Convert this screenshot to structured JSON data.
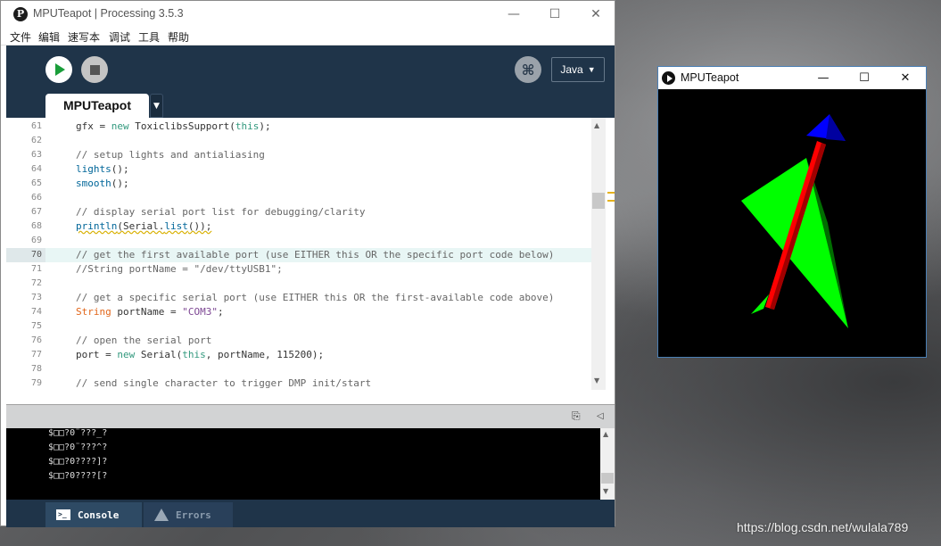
{
  "ide": {
    "title": "MPUTeapot | Processing 3.5.3",
    "app_icon": "P",
    "window_controls": {
      "minimize": "—",
      "maximize": "☐",
      "close": "✕"
    },
    "menu": [
      "文件",
      "编辑",
      "速写本",
      "调试",
      "工具",
      "帮助"
    ],
    "mode_label": "Java",
    "tab_label": "MPUTeapot",
    "code_lines": [
      {
        "num": "61",
        "text": "gfx = new ToxiclibsSupport(this);"
      },
      {
        "num": "62",
        "text": ""
      },
      {
        "num": "63",
        "text": "// setup lights and antialiasing"
      },
      {
        "num": "64",
        "text": "lights();"
      },
      {
        "num": "65",
        "text": "smooth();"
      },
      {
        "num": "66",
        "text": ""
      },
      {
        "num": "67",
        "text": "// display serial port list for debugging/clarity"
      },
      {
        "num": "68",
        "text": "println(Serial.list());"
      },
      {
        "num": "69",
        "text": ""
      },
      {
        "num": "70",
        "text": "// get the first available port (use EITHER this OR the specific port code below)"
      },
      {
        "num": "71",
        "text": "//String portName = \"/dev/ttyUSB1\";"
      },
      {
        "num": "72",
        "text": ""
      },
      {
        "num": "73",
        "text": "// get a specific serial port (use EITHER this OR the first-available code above)"
      },
      {
        "num": "74",
        "text": "String portName = \"COM3\";"
      },
      {
        "num": "75",
        "text": ""
      },
      {
        "num": "76",
        "text": "// open the serial port"
      },
      {
        "num": "77",
        "text": "port = new Serial(this, portName, 115200);"
      },
      {
        "num": "78",
        "text": ""
      },
      {
        "num": "79",
        "text": "// send single character to trigger DMP init/start"
      }
    ],
    "highlighted_line": "70",
    "console_lines": [
      "$□□?0¨???_?",
      "$□□?0¨???^?",
      "$□□?0????]?",
      "$□□?0????[?"
    ],
    "bottom_tabs": {
      "console": "Console",
      "errors": "Errors"
    }
  },
  "sketch": {
    "title": "MPUTeapot",
    "window_controls": {
      "minimize": "—",
      "maximize": "☐",
      "close": "✕"
    },
    "colors": {
      "wing": "#00ff00",
      "body": "#ff0000",
      "nose": "#0000ff"
    }
  },
  "watermark": "https://blog.csdn.net/wulala789"
}
